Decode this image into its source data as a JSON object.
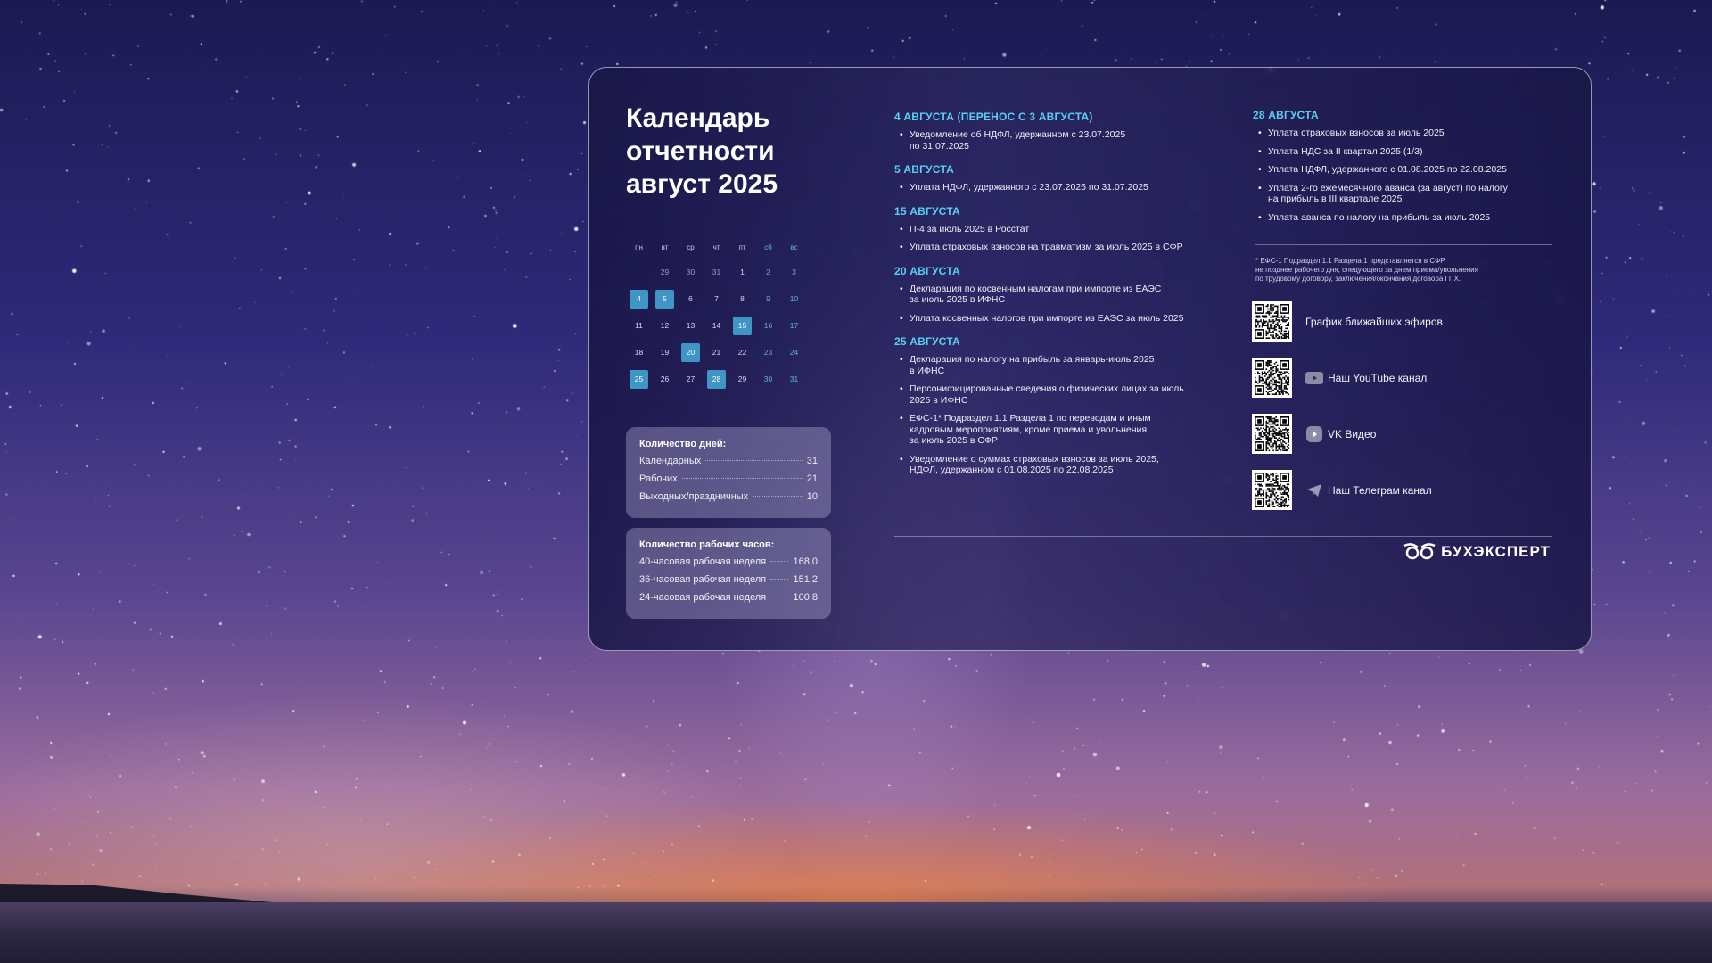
{
  "page": {
    "title": "Календарь отчетности август 2025"
  },
  "calendar": {
    "weekdays": [
      "пн",
      "вт",
      "ср",
      "чт",
      "пт",
      "сб",
      "вс"
    ],
    "weeks": [
      [
        {
          "d": "",
          "t": "empty"
        },
        {
          "d": "29",
          "t": "other"
        },
        {
          "d": "30",
          "t": "other"
        },
        {
          "d": "31",
          "t": "other"
        },
        {
          "d": "1",
          "t": "normal"
        },
        {
          "d": "2",
          "t": "weekend"
        },
        {
          "d": "3",
          "t": "weekend"
        }
      ],
      [
        {
          "d": "4",
          "t": "highlight"
        },
        {
          "d": "5",
          "t": "highlight"
        },
        {
          "d": "6",
          "t": "normal"
        },
        {
          "d": "7",
          "t": "normal"
        },
        {
          "d": "8",
          "t": "normal"
        },
        {
          "d": "9",
          "t": "weekend"
        },
        {
          "d": "10",
          "t": "weekend"
        }
      ],
      [
        {
          "d": "11",
          "t": "normal"
        },
        {
          "d": "12",
          "t": "normal"
        },
        {
          "d": "13",
          "t": "normal"
        },
        {
          "d": "14",
          "t": "normal"
        },
        {
          "d": "15",
          "t": "highlight"
        },
        {
          "d": "16",
          "t": "weekend"
        },
        {
          "d": "17",
          "t": "weekend"
        }
      ],
      [
        {
          "d": "18",
          "t": "normal"
        },
        {
          "d": "19",
          "t": "normal"
        },
        {
          "d": "20",
          "t": "highlight"
        },
        {
          "d": "21",
          "t": "normal"
        },
        {
          "d": "22",
          "t": "normal"
        },
        {
          "d": "23",
          "t": "weekend"
        },
        {
          "d": "24",
          "t": "weekend"
        }
      ],
      [
        {
          "d": "25",
          "t": "highlight"
        },
        {
          "d": "26",
          "t": "normal"
        },
        {
          "d": "27",
          "t": "normal"
        },
        {
          "d": "28",
          "t": "highlight"
        },
        {
          "d": "29",
          "t": "normal"
        },
        {
          "d": "30",
          "t": "weekend"
        },
        {
          "d": "31",
          "t": "weekend"
        }
      ]
    ]
  },
  "days_box": {
    "title": "Количество дней:",
    "rows": [
      {
        "label": "Календарных",
        "value": "31"
      },
      {
        "label": "Рабочих",
        "value": "21"
      },
      {
        "label": "Выходных/праздничных",
        "value": "10"
      }
    ]
  },
  "hours_box": {
    "title": "Количество рабочих часов:",
    "rows": [
      {
        "label": "40-часовая рабочая неделя",
        "value": "168,0"
      },
      {
        "label": "36-часовая рабочая неделя",
        "value": "151,2"
      },
      {
        "label": "24-часовая рабочая неделя",
        "value": "100,8"
      }
    ]
  },
  "deadlines_left": [
    {
      "title": "4 АВГУСТА (ПЕРЕНОС С 3 АВГУСТА)",
      "items": [
        "Уведомление об НДФЛ, удержанном с 23.07.2025\nпо 31.07.2025"
      ]
    },
    {
      "title": "5 АВГУСТА",
      "items": [
        "Уплата НДФЛ, удержанного с 23.07.2025 по 31.07.2025"
      ]
    },
    {
      "title": "15 АВГУСТА",
      "items": [
        "П-4 за июль 2025 в Росстат",
        "Уплата страховых взносов на травматизм за июль 2025 в СФР"
      ]
    },
    {
      "title": "20 АВГУСТА",
      "items": [
        "Декларация по косвенным налогам при импорте из ЕАЭС\nза июль 2025  в ИФНС",
        "Уплата косвенных налогов при импорте из ЕАЭС за июль 2025"
      ]
    },
    {
      "title": "25 АВГУСТА",
      "items": [
        "Декларация по налогу на прибыль за январь-июль 2025\nв ИФНС",
        "Персонифицированные сведения о физических лицах за июль\n2025 в ИФНС",
        "ЕФС-1* Подраздел 1.1 Раздела 1 по переводам и иным\nкадровым мероприятиям, кроме приема и увольнения,\nза июль 2025 в СФР",
        "Уведомление о суммах страховых взносов за июль 2025,\nНДФЛ, удержанном с 01.08.2025 по 22.08.2025"
      ]
    }
  ],
  "deadlines_right": [
    {
      "title": "28 АВГУСТА",
      "items": [
        "Уплата страховых взносов за июль 2025",
        "Уплата НДС за II квартал 2025 (1/3)",
        "Уплата НДФЛ, удержанного с 01.08.2025 по 22.08.2025",
        "Уплата 2-го ежемесячного аванса (за август) по налогу\nна прибыль в III квартале 2025",
        "Уплата аванса по налогу на прибыль за июль 2025"
      ]
    }
  ],
  "footnote": "* ЕФС-1 Подраздел 1.1 Раздела 1 представляется в СФР\nне позднее рабочего дня, следующего за днем приема/увольнения\nпо трудовому договору, заключения/окончания договора ГПХ.",
  "links": [
    {
      "label": "График ближайших эфиров",
      "icon": "none"
    },
    {
      "label": "Наш YouTube канал",
      "icon": "youtube-icon"
    },
    {
      "label": "VK Видео",
      "icon": "vk-video-icon"
    },
    {
      "label": "Наш Телеграм канал",
      "icon": "telegram-icon"
    }
  ],
  "brand": {
    "name": "БУХЭКСПЕРТ"
  },
  "colors": {
    "accent": "#58d0f0",
    "highlight_day": "#3f95c4",
    "weekend": "#5fb0e0"
  }
}
